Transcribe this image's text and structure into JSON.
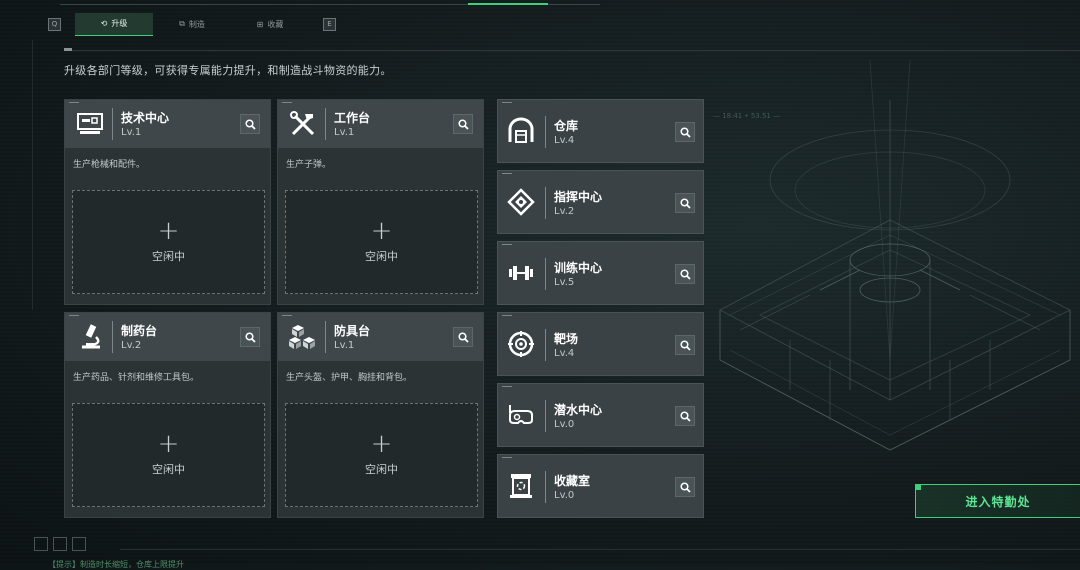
{
  "tabs": {
    "left_key": "Q",
    "right_key": "E",
    "items": [
      {
        "label": "升级",
        "icon": "upgrade-icon",
        "active": true
      },
      {
        "label": "制造",
        "icon": "craft-icon",
        "active": false
      },
      {
        "label": "收藏",
        "icon": "collection-icon",
        "active": false
      }
    ]
  },
  "description": "升级各部门等级，可获得专属能力提升，和制造战斗物资的能力。",
  "departments": [
    {
      "name": "技术中心",
      "level": "Lv.1",
      "desc": "生产枪械和配件。",
      "slot_label": "空闲中",
      "icon": "computer-icon"
    },
    {
      "name": "工作台",
      "level": "Lv.1",
      "desc": "生产子弹。",
      "slot_label": "空闲中",
      "icon": "tools-icon"
    },
    {
      "name": "制药台",
      "level": "Lv.2",
      "desc": "生产药品、针剂和维修工具包。",
      "slot_label": "空闲中",
      "icon": "microscope-icon"
    },
    {
      "name": "防具台",
      "level": "Lv.1",
      "desc": "生产头盔、护甲、胸挂和背包。",
      "slot_label": "空闲中",
      "icon": "cubes-icon"
    }
  ],
  "facilities": [
    {
      "name": "仓库",
      "level": "Lv.4",
      "icon": "warehouse-icon"
    },
    {
      "name": "指挥中心",
      "level": "Lv.2",
      "icon": "chip-icon"
    },
    {
      "name": "训练中心",
      "level": "Lv.5",
      "icon": "dumbbell-icon"
    },
    {
      "name": "靶场",
      "level": "Lv.4",
      "icon": "target-icon"
    },
    {
      "name": "潜水中心",
      "level": "Lv.0",
      "icon": "diving-mask-icon"
    },
    {
      "name": "收藏室",
      "level": "Lv.0",
      "icon": "trophy-icon"
    }
  ],
  "enter_button": "进入特勤处",
  "bottom_note": "【提示】制造时长缩短，仓库上限提升",
  "colors": {
    "accent": "#3ecf7a",
    "panel": "#3a4245",
    "card": "#2b3335"
  }
}
